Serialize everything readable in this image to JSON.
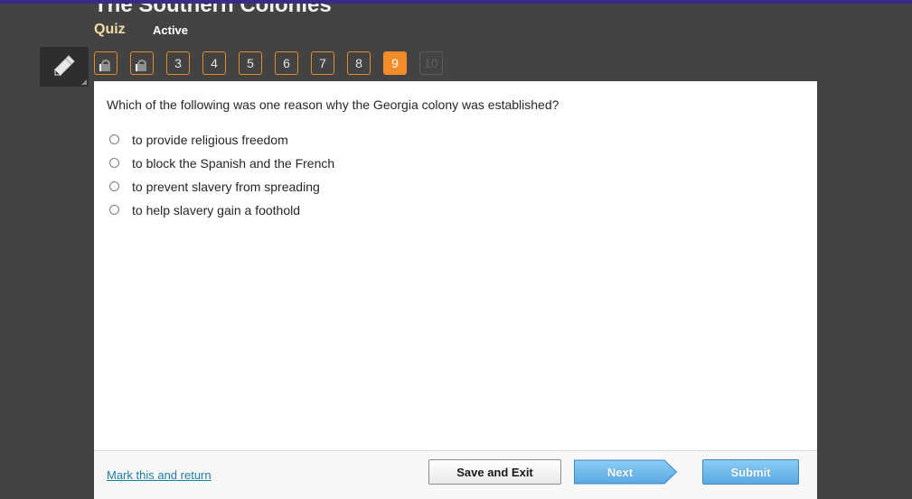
{
  "header": {
    "title": "The Southern Colonies",
    "assignment_type": "Quiz",
    "status": "Active"
  },
  "tools": {
    "pencil_icon": "pencil-icon"
  },
  "question_nav": {
    "items": [
      {
        "label": "",
        "state": "locked",
        "icon": "lock-icon"
      },
      {
        "label": "",
        "state": "locked",
        "icon": "lock-icon"
      },
      {
        "label": "3",
        "state": "normal"
      },
      {
        "label": "4",
        "state": "normal"
      },
      {
        "label": "5",
        "state": "normal"
      },
      {
        "label": "6",
        "state": "normal"
      },
      {
        "label": "7",
        "state": "normal"
      },
      {
        "label": "8",
        "state": "normal"
      },
      {
        "label": "9",
        "state": "current"
      },
      {
        "label": "10",
        "state": "disabled"
      }
    ],
    "accent_color": "#f28c28"
  },
  "question": {
    "text": "Which of the following was one reason why the Georgia colony was established?",
    "options": [
      {
        "label": "to provide religious freedom",
        "selected": false
      },
      {
        "label": "to block the Spanish and the French",
        "selected": false
      },
      {
        "label": "to prevent slavery from spreading",
        "selected": false
      },
      {
        "label": "to help slavery gain a foothold",
        "selected": false
      }
    ]
  },
  "footer": {
    "mark_link": "Mark this and return",
    "save_label": "Save and Exit",
    "next_label": "Next",
    "submit_label": "Submit"
  }
}
